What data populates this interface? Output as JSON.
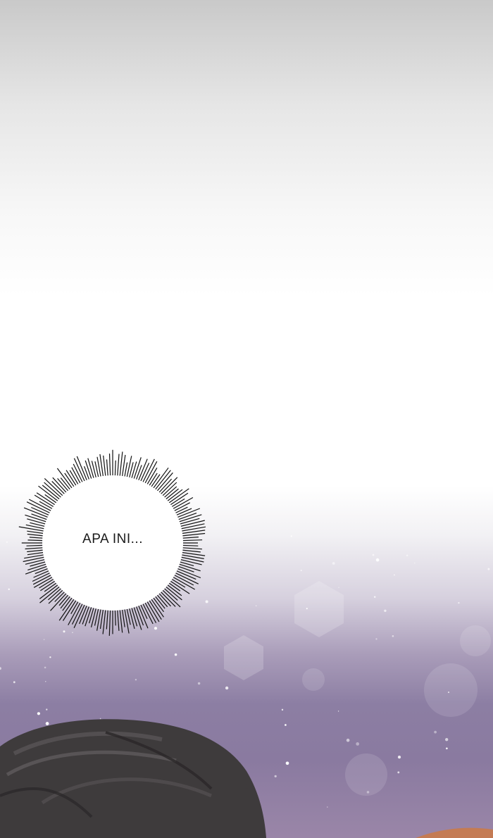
{
  "bubble": {
    "text": "APA INI..."
  }
}
